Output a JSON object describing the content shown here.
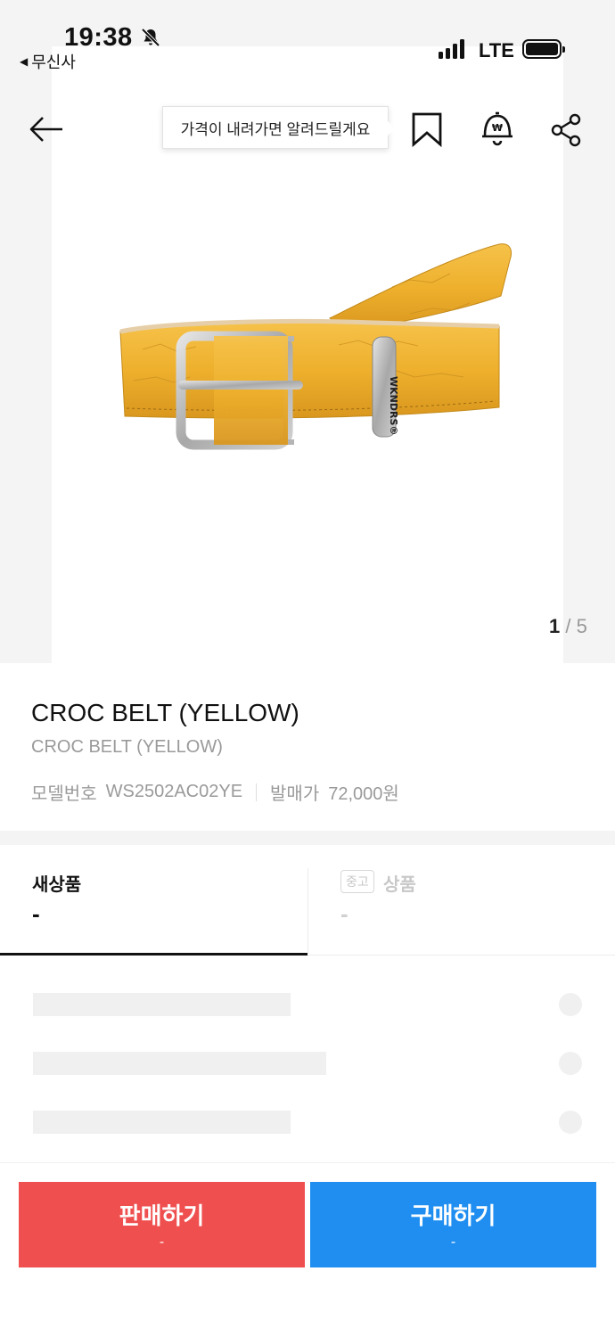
{
  "status_bar": {
    "time": "19:38",
    "back_app": "무신사",
    "carrier": "LTE"
  },
  "nav": {
    "tooltip": "가격이 내려가면 알려드릴게요",
    "icons": [
      "back-arrow-icon",
      "bookmark-icon",
      "price-alert-bell-icon",
      "share-icon"
    ]
  },
  "gallery": {
    "current": "1",
    "separator": " / ",
    "total": "5",
    "image_text": "WKNDRS®"
  },
  "product": {
    "title": "CROC BELT (YELLOW)",
    "subtitle": "CROC BELT (YELLOW)",
    "model_label": "모델번호",
    "model_number": "WS2502AC02YE",
    "release_label": "발매가",
    "release_price": "72,000원"
  },
  "tabs": {
    "new": {
      "label": "새상품",
      "price": "-"
    },
    "used": {
      "badge": "중고",
      "label": "상품",
      "price": "-"
    }
  },
  "actions": {
    "sell": {
      "label": "판매하기",
      "price": "-"
    },
    "buy": {
      "label": "구매하기",
      "price": "-"
    }
  },
  "colors": {
    "sell": "#ef4f4f",
    "buy": "#1f8ef0",
    "belt": "#f0b230"
  }
}
